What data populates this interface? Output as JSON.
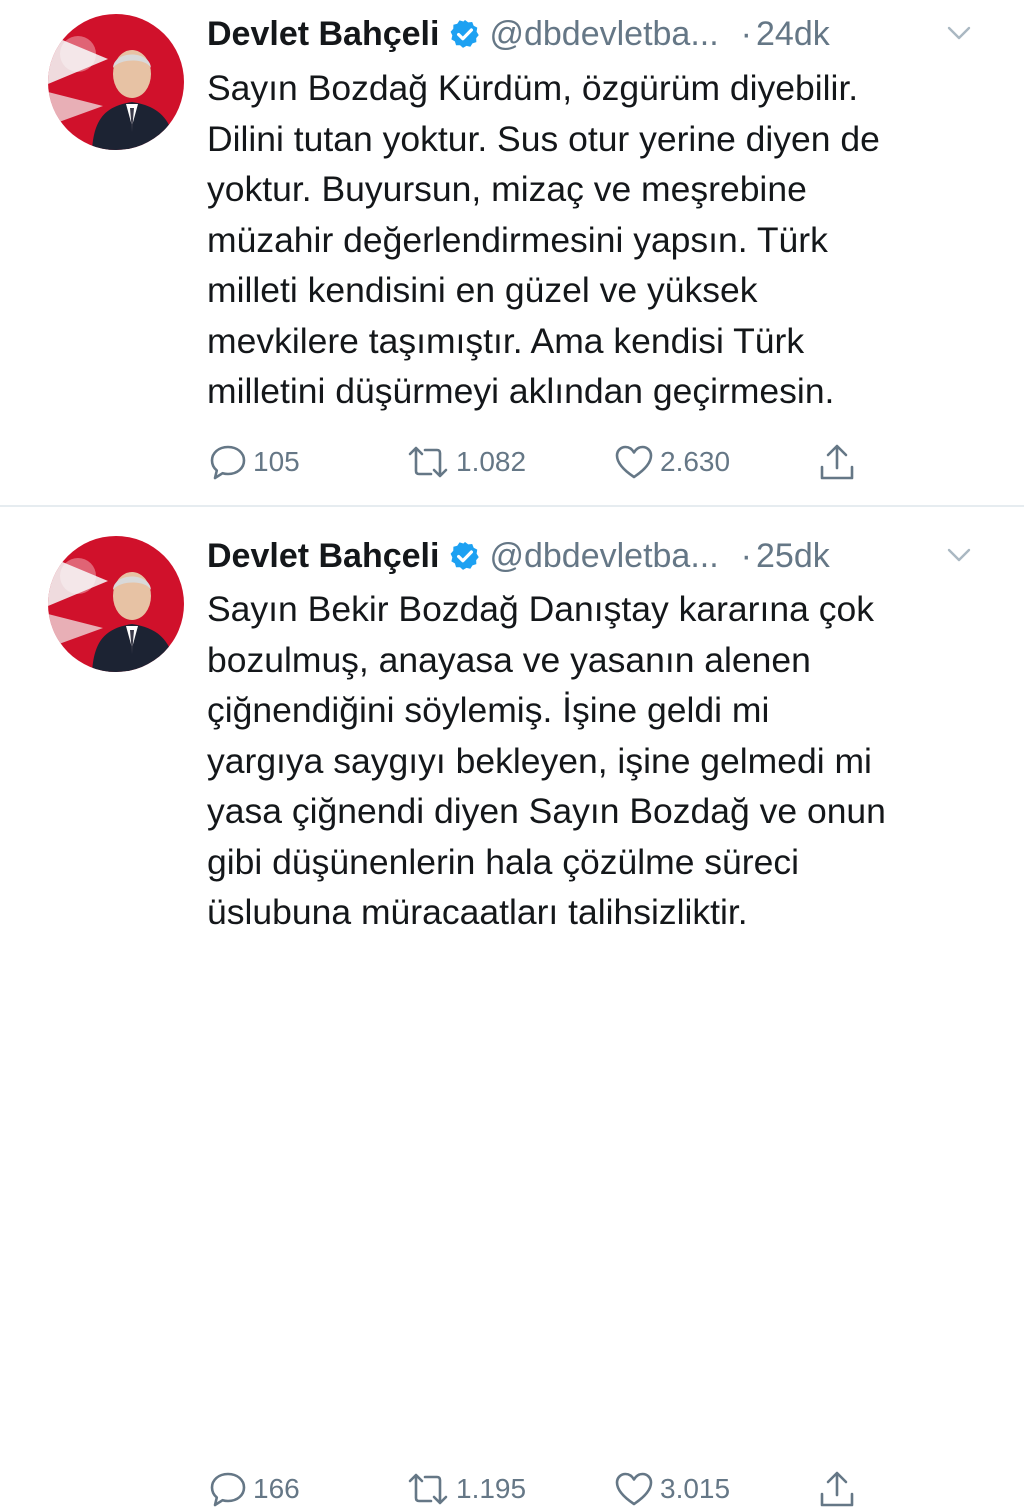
{
  "colors": {
    "text_primary": "#14171a",
    "text_secondary": "#657786",
    "verified_blue": "#1da1f2",
    "divider": "#e6ecf0",
    "avatar_flag_red": "#d0112b"
  },
  "icons": {
    "verified": "verified-badge-icon",
    "chevron": "chevron-down-icon",
    "reply": "reply-bubble-icon",
    "retweet": "retweet-icon",
    "like": "heart-icon",
    "share": "share-upload-icon"
  },
  "tweets": [
    {
      "author_name": "Devlet Bahçeli",
      "handle": "@dbdevletba...",
      "separator": "·",
      "time": "24dk",
      "lines": [
        "Sayın Bozdağ Kürdüm, özgürüm diyebilir.",
        "Dilini tutan yoktur. Sus otur yerine diyen de",
        "yoktur. Buyursun, mizaç ve meşrebine",
        "müzahir değerlendirmesini yapsın. Türk",
        "milleti kendisini en güzel ve yüksek",
        "mevkilere taşımıştır. Ama kendisi Türk",
        "milletini düşürmeyi aklından geçirmesin."
      ],
      "replies": "105",
      "retweets": "1.082",
      "likes": "2.630"
    },
    {
      "author_name": "Devlet Bahçeli",
      "handle": "@dbdevletba...",
      "separator": "·",
      "time": "25dk",
      "lines": [
        "Sayın Bekir Bozdağ Danıştay kararına çok",
        "bozulmuş, anayasa ve yasanın alenen",
        "çiğnendiğini söylemiş. İşine geldi mi",
        "yargıya saygıyı bekleyen, işine gelmedi mi",
        "yasa çiğnendi diyen Sayın Bozdağ ve onun",
        "gibi düşünenlerin hala çözülme süreci",
        "üslubuna müracaatları talihsizliktir."
      ],
      "replies": "166",
      "retweets": "1.195",
      "likes": "3.015"
    }
  ]
}
